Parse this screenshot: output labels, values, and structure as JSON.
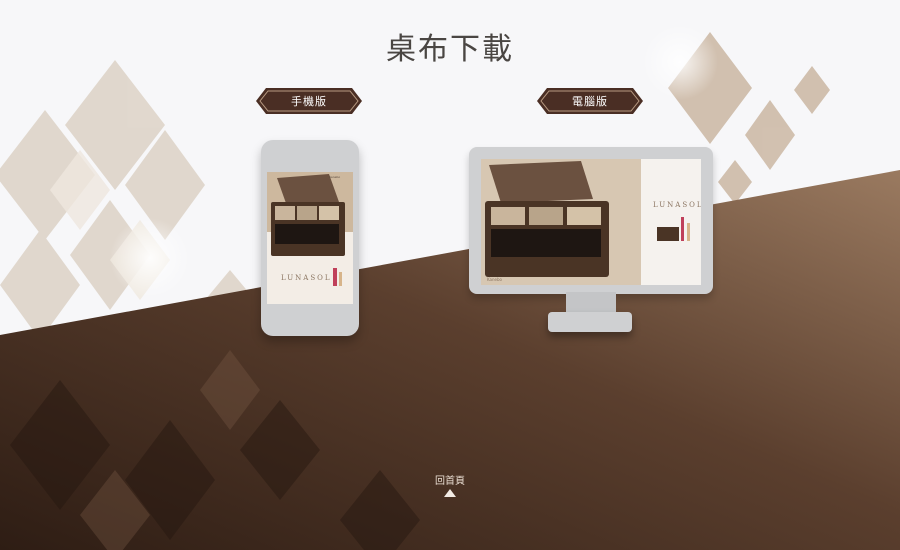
{
  "page": {
    "title": "桌布下載"
  },
  "buttons": {
    "mobile_label": "手機版",
    "desktop_label": "電腦版"
  },
  "footer": {
    "back_home_label": "回首頁",
    "back_home_icon": "triangle-up-icon"
  },
  "wallpaper": {
    "brand": "LUNASOL",
    "small_brand": "Kanebo"
  },
  "colors": {
    "brown_dark": "#3a2418",
    "brown_light": "#8e6d55",
    "button_fill": "#4a2e24",
    "device_gray": "#cfd0d2",
    "title": "#4a4643"
  }
}
